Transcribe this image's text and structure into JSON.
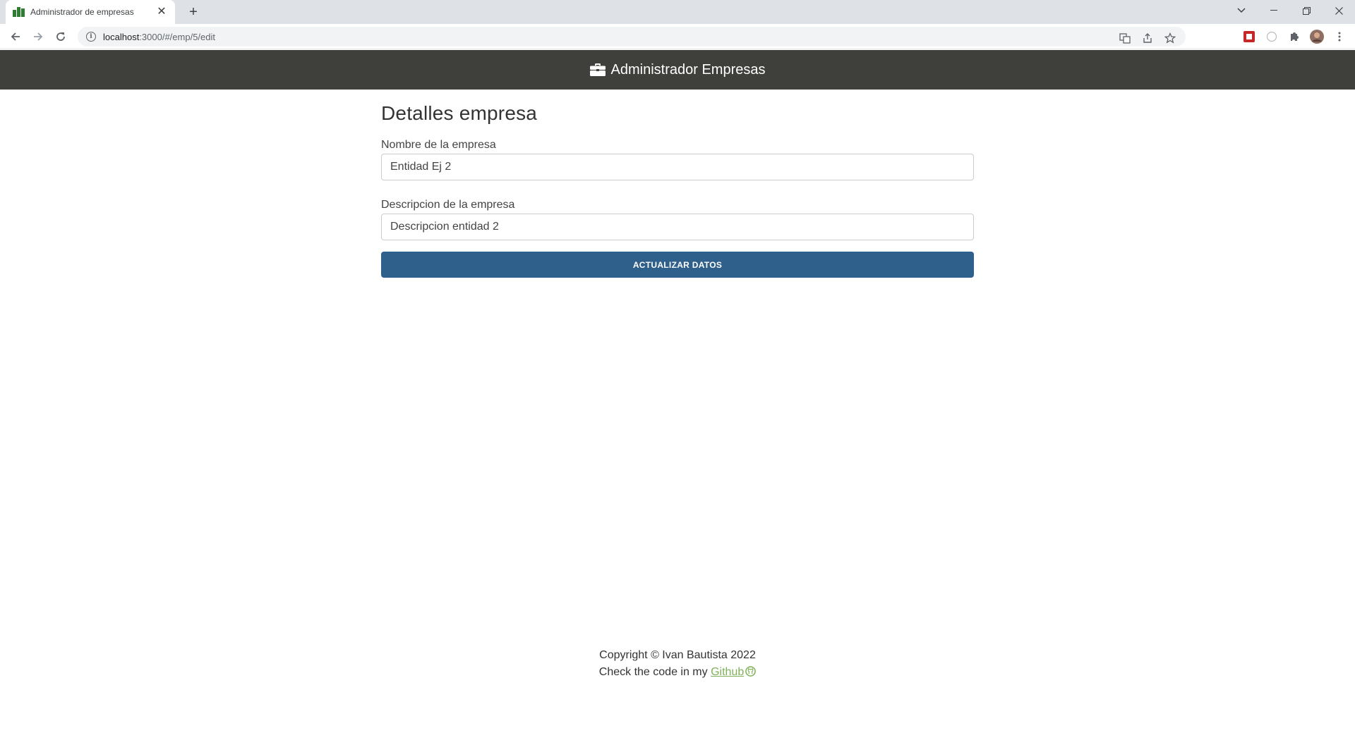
{
  "browser": {
    "tab_title": "Administrador de empresas",
    "tab_close": "✕",
    "new_tab": "+",
    "url_host": "localhost",
    "url_rest": ":3000/#/emp/5/edit"
  },
  "header": {
    "brand": "Administrador Empresas"
  },
  "form": {
    "title": "Detalles empresa",
    "name_label": "Nombre de la empresa",
    "name_value": "Entidad Ej 2",
    "desc_label": "Descripcion de la empresa",
    "desc_value": "Descripcion entidad 2",
    "submit_label": "ACTUALIZAR DATOS"
  },
  "footer": {
    "copyright": "Copyright © Ivan Bautista 2022",
    "check_text": "Check the code in my ",
    "link_text": "Github"
  },
  "colors": {
    "header_bg": "#3f3f3b",
    "button_bg": "#2f5f8b",
    "link": "#7fb05a"
  }
}
